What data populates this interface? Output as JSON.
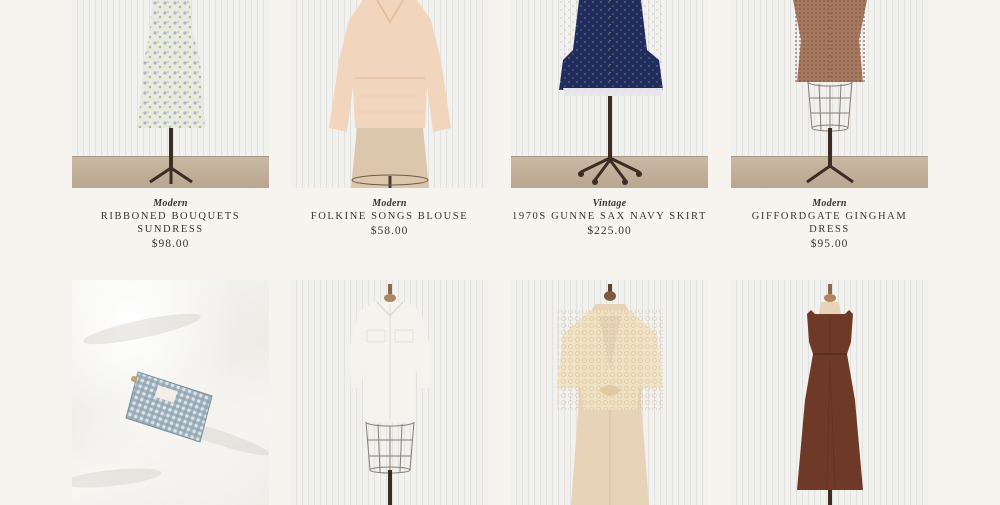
{
  "products": [
    {
      "tag": "Modern",
      "name": "Ribboned Bouquets Sundress",
      "price": "$98.00",
      "image": "dress-form-floral-sundress"
    },
    {
      "tag": "Modern",
      "name": "Folkine Songs Blouse",
      "price": "$58.00",
      "image": "dress-form-peach-blouse"
    },
    {
      "tag": "Vintage",
      "name": "1970s Gunne Sax Navy Skirt",
      "price": "$225.00",
      "image": "dress-form-navy-dress"
    },
    {
      "tag": "Modern",
      "name": "Giffordgate Gingham Dress",
      "price": "$95.00",
      "image": "dress-form-brown-gingham-dress"
    },
    {
      "image": "gingham-pouch-on-linen"
    },
    {
      "image": "dress-form-white-shirt-dress"
    },
    {
      "image": "dress-form-lace-crochet-top"
    },
    {
      "image": "dress-form-brown-midi-dress"
    }
  ],
  "colors": {
    "background": "#f7f4ef",
    "text": "#3a3330"
  }
}
